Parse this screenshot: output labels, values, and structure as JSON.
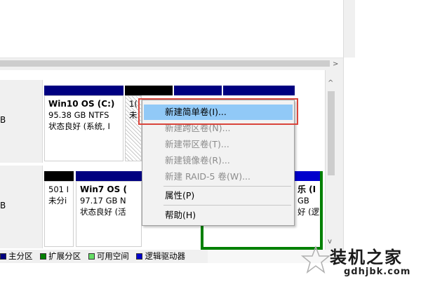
{
  "scrollbar": {
    "right_arrow": ">",
    "up_arrow": "^",
    "down_arrow": "v"
  },
  "disks": [
    {
      "label_fragment": "B"
    },
    {
      "label_fragment": "B"
    }
  ],
  "disk0_partitions": [
    {
      "lines": [
        "Win10 OS  (C:)",
        "95.38 GB NTFS",
        "状态良好 (系统, I"
      ]
    },
    {
      "lines": [
        "1(",
        "未"
      ]
    }
  ],
  "disk1_partitions": [
    {
      "lines": [
        "501 I",
        "未分i"
      ]
    },
    {
      "lines": [
        "Win7 OS  (",
        "97.17 GB N",
        "状态良好 (活"
      ]
    },
    {
      "lines": [
        "乐 (I",
        "GB",
        "好 (逻"
      ]
    }
  ],
  "legend": [
    {
      "label": "主分区",
      "color": "#000080"
    },
    {
      "label": "扩展分区",
      "color": "#008000"
    },
    {
      "label": "可用空间",
      "color": "#66dd66"
    },
    {
      "label": "逻辑驱动器",
      "color": "#0000cc"
    }
  ],
  "context_menu": {
    "items": [
      {
        "label": "新建简单卷(I)...",
        "enabled": true,
        "highlighted": true
      },
      {
        "label": "新建跨区卷(N)...",
        "enabled": false
      },
      {
        "label": "新建带区卷(T)...",
        "enabled": false
      },
      {
        "label": "新建镜像卷(R)...",
        "enabled": false
      },
      {
        "label": "新建 RAID-5 卷(W)...",
        "enabled": false
      },
      {
        "label": "属性(P)",
        "enabled": true
      },
      {
        "label": "帮助(H)",
        "enabled": true
      }
    ]
  },
  "watermark": {
    "title": "装机之家",
    "url": "gdhjbk.com"
  },
  "colors": {
    "primary_partition": "#000080",
    "menu_highlight": "#91c9f7",
    "callout_border": "#d9453c"
  }
}
